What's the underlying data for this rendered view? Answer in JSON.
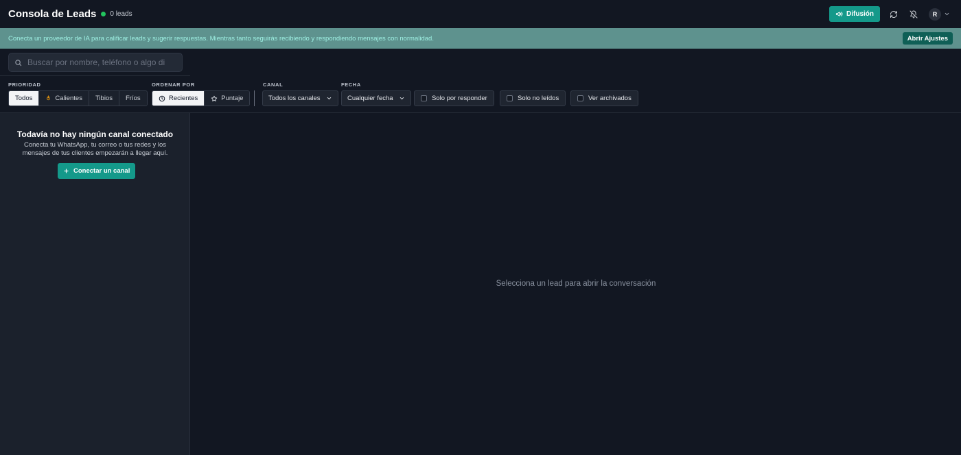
{
  "header": {
    "title": "Consola de Leads",
    "lead_count": "0 leads",
    "status_color": "#22c55e",
    "broadcast_label": "Difusión",
    "avatar_initial": "R",
    "icons": [
      "megaphone-icon",
      "refresh-icon",
      "bell-off-icon",
      "chevron-down-icon"
    ]
  },
  "banner": {
    "text": "Conecta un proveedor de IA para calificar leads y sugerir respuestas. Mientras tanto seguirás recibiendo y respondiendo mensajes con normalidad.",
    "button_label": "Abrir Ajustes"
  },
  "search": {
    "placeholder": "Buscar por nombre, teléfono o algo dicho",
    "value": ""
  },
  "filters": {
    "priority": {
      "label": "PRIORIDAD",
      "options": [
        "Todos",
        "Calientes",
        "Tibios",
        "Fríos"
      ],
      "selected": "Todos"
    },
    "sort": {
      "label": "ORDENAR POR",
      "options": [
        "Recientes",
        "Puntaje"
      ],
      "selected": "Recientes"
    },
    "channel": {
      "label": "CANAL",
      "value": "Todos los canales"
    },
    "date": {
      "label": "FECHA",
      "value": "Cualquier fecha"
    },
    "toggles": {
      "unanswered": {
        "label": "Solo por responder",
        "checked": false
      },
      "unread": {
        "label": "Solo no leídos",
        "checked": false
      },
      "archived": {
        "label": "Ver archivados",
        "checked": false
      }
    }
  },
  "sidebar": {
    "empty_title": "Todavía no hay ningún canal conectado",
    "empty_description": "Conecta tu WhatsApp, tu correo o tus redes y los mensajes de tus clientes empezarán a llegar aquí.",
    "connect_label": "Conectar un canal"
  },
  "main": {
    "placeholder": "Selecciona un lead para abrir la conversación"
  },
  "colors": {
    "accent": "#14998a",
    "banner_bg": "#5e928e",
    "banner_text": "#9ef0e3",
    "background": "#121722",
    "sidebar_bg": "#1b212c"
  }
}
